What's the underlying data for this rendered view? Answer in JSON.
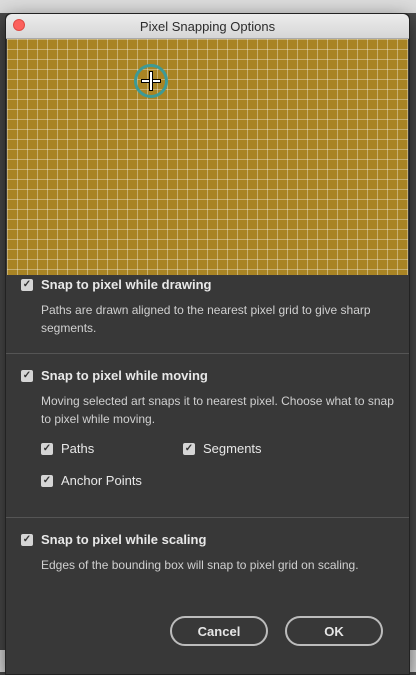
{
  "window": {
    "title": "Pixel Snapping Options"
  },
  "sections": {
    "drawing": {
      "label": "Snap to pixel while drawing",
      "checked": true,
      "description": "Paths are drawn aligned to the nearest pixel grid to give sharp segments."
    },
    "moving": {
      "label": "Snap to pixel while moving",
      "checked": true,
      "description": "Moving selected art snaps it to nearest pixel. Choose what to snap to pixel while moving.",
      "options": [
        {
          "label": "Paths",
          "checked": true
        },
        {
          "label": "Segments",
          "checked": true
        },
        {
          "label": "Anchor Points",
          "checked": true
        }
      ]
    },
    "scaling": {
      "label": "Snap to pixel while scaling",
      "checked": true,
      "description": "Edges of the bounding box will snap to pixel grid on scaling."
    }
  },
  "buttons": {
    "cancel": "Cancel",
    "ok": "OK"
  },
  "icons": {
    "check": "✓"
  },
  "colors": {
    "preview_fill": "#a98424",
    "cursor_ring": "#3d9a96",
    "dialog_bg": "#383838"
  }
}
